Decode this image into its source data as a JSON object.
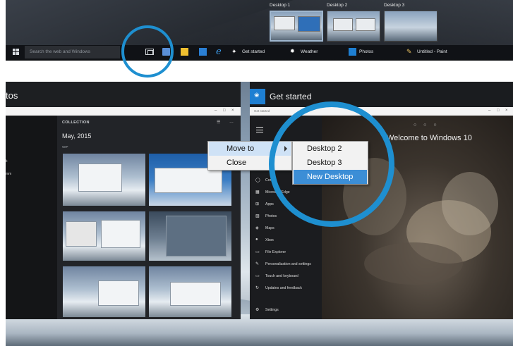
{
  "top": {
    "desktops": [
      {
        "label": "Desktop 1",
        "active": true
      },
      {
        "label": "Desktop 2",
        "active": false
      },
      {
        "label": "Desktop 3",
        "active": false
      }
    ],
    "taskbar": {
      "search_placeholder": "Search the web and Windows",
      "apps": [
        {
          "label": "Get started",
          "icon": "lightbulb-icon"
        },
        {
          "label": "Weather",
          "icon": "sun-icon"
        },
        {
          "label": "Photos",
          "icon": "photos-icon"
        },
        {
          "label": "Untitled - Paint",
          "icon": "paint-icon"
        }
      ],
      "pinned": [
        "settings-icon",
        "file-explorer-icon",
        "store-icon",
        "edge-icon"
      ]
    },
    "highlight_color": "#1e8fd0"
  },
  "photos_window": {
    "title": "tos",
    "nav_items": [
      "k",
      "mm"
    ],
    "collection_label": "COLLECTION",
    "date": "May, 2015",
    "sub": "WIP"
  },
  "getstarted_window": {
    "title": "Get started",
    "hero_text": "Welcome to Windows 10",
    "pager": "○ ○ ○",
    "menu": [
      {
        "icon": "◯",
        "label": "Corta"
      },
      {
        "icon": "▦",
        "label": "Microsoft Edge"
      },
      {
        "icon": "⊞",
        "label": "Apps"
      },
      {
        "icon": "▨",
        "label": "Photos"
      },
      {
        "icon": "◈",
        "label": "Maps"
      },
      {
        "icon": "●",
        "label": "Xbox"
      },
      {
        "icon": "▭",
        "label": "File Explorer"
      },
      {
        "icon": "✎",
        "label": "Personalization and settings"
      },
      {
        "icon": "▭",
        "label": "Touch and keyboard"
      },
      {
        "icon": "↻",
        "label": "Updates and feedback"
      }
    ],
    "settings_label": "Settings"
  },
  "context_menu": {
    "items": [
      {
        "label": "Move to",
        "has_submenu": true
      },
      {
        "label": "Close",
        "has_submenu": false
      }
    ]
  },
  "submenu": {
    "items": [
      {
        "label": "Desktop 2"
      },
      {
        "label": "Desktop 3"
      },
      {
        "label": "New Desktop"
      }
    ],
    "selected": "New Desktop"
  }
}
